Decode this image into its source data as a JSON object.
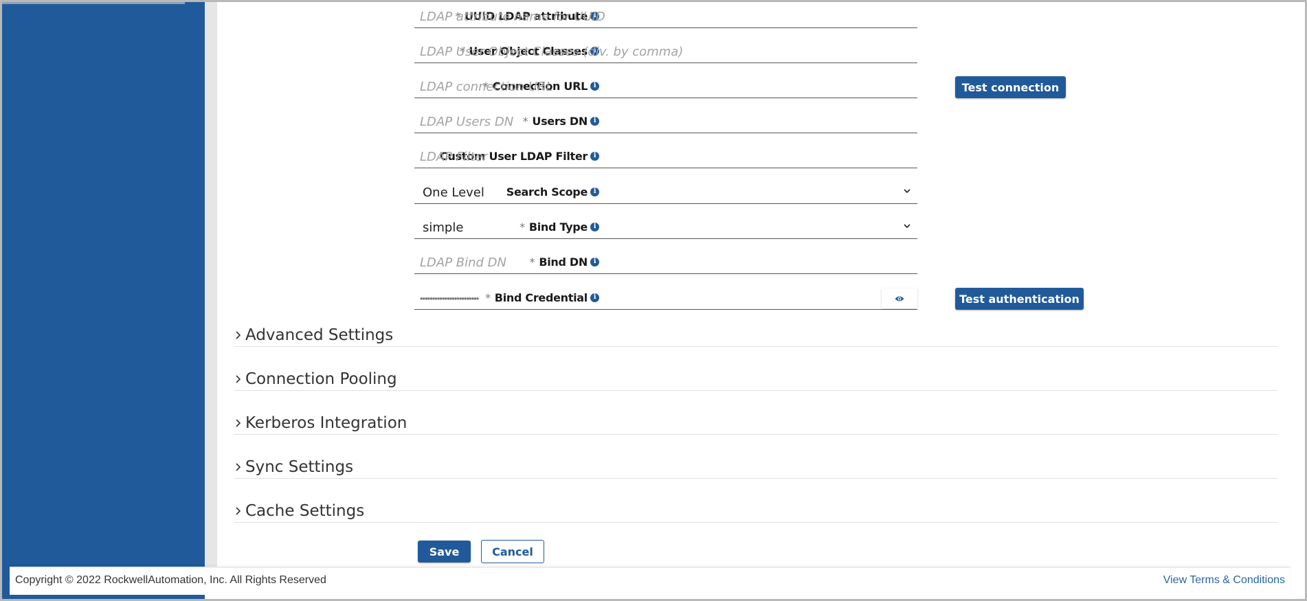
{
  "form": {
    "fields": [
      {
        "label": "UUID LDAP attribute",
        "required": true,
        "type": "text",
        "placeholder": "LDAP attribute name for UUID",
        "value": ""
      },
      {
        "label": "User Object Classes",
        "required": true,
        "type": "text",
        "placeholder": "LDAP User Object Classes (div. by comma)",
        "value": ""
      },
      {
        "label": "Connection URL",
        "required": true,
        "type": "text",
        "placeholder": "LDAP connection URL",
        "value": ""
      },
      {
        "label": "Users DN",
        "required": true,
        "type": "text",
        "placeholder": "LDAP Users DN",
        "value": ""
      },
      {
        "label": "Custom User LDAP Filter",
        "required": false,
        "type": "text",
        "placeholder": "LDAP Filter",
        "value": ""
      },
      {
        "label": "Search Scope",
        "required": false,
        "type": "select",
        "value": "One Level"
      },
      {
        "label": "Bind Type",
        "required": true,
        "type": "select",
        "value": "simple"
      },
      {
        "label": "Bind DN",
        "required": true,
        "type": "text",
        "placeholder": "LDAP Bind DN",
        "value": ""
      },
      {
        "label": "Bind Credential",
        "required": true,
        "type": "password",
        "value": "••••••••••••••••••••••••"
      }
    ],
    "required_marker": "*",
    "info_glyph": "i",
    "test_connection_label": "Test connection",
    "test_authentication_label": "Test authentication"
  },
  "sections": [
    {
      "title": "Advanced Settings",
      "expanded": false
    },
    {
      "title": "Connection Pooling",
      "expanded": false
    },
    {
      "title": "Kerberos Integration",
      "expanded": false
    },
    {
      "title": "Sync Settings",
      "expanded": false
    },
    {
      "title": "Cache Settings",
      "expanded": false
    }
  ],
  "actions": {
    "save_label": "Save",
    "cancel_label": "Cancel"
  },
  "footer": {
    "copyright": "Copyright © 2022 RockwellAutomation, Inc. All Rights Reserved",
    "terms_link": "View Terms & Conditions"
  },
  "colors": {
    "brand": "#205a9a",
    "sidebar": "#205a9a",
    "link": "#2a65a3"
  },
  "icons": {
    "info": "info-icon",
    "select_arrow": "chevron-down-icon",
    "password_toggle": "eye-icon",
    "section_collapsed": "chevron-right-icon"
  }
}
